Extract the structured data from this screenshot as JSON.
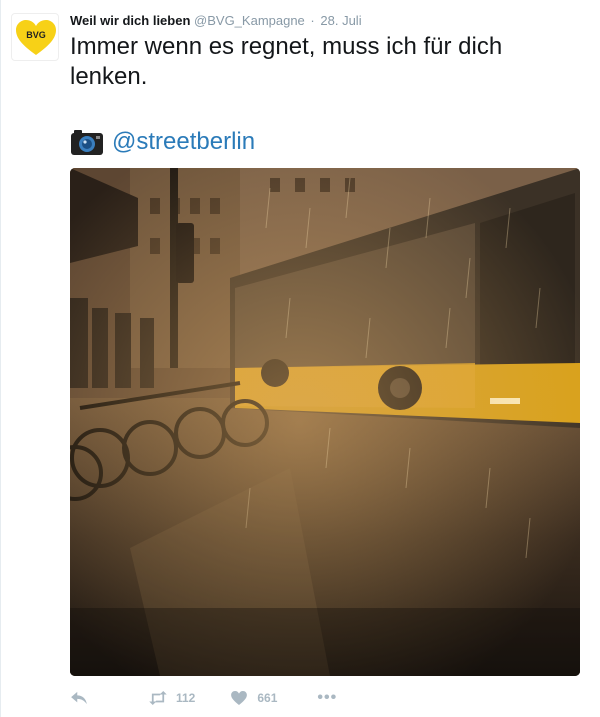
{
  "tweet": {
    "author_name": "Weil wir dich lieben",
    "handle": "@BVG_Kampagne",
    "separator": "·",
    "date": "28. Juli",
    "text": "Immer wenn es regnet, muss ich für dich lenken.",
    "photo_credit": "@streetberlin",
    "avatar_text": "BVG"
  },
  "actions": {
    "reply_icon": "reply-icon",
    "retweet_icon": "retweet-icon",
    "retweet_count": "112",
    "like_icon": "heart-icon",
    "like_count": "661",
    "more_label": "•••"
  },
  "colors": {
    "brand_yellow": "#f7d117",
    "link_blue": "#2b7bb9",
    "muted_gray": "#aab8c2",
    "bus_orange": "#d9a21a"
  }
}
